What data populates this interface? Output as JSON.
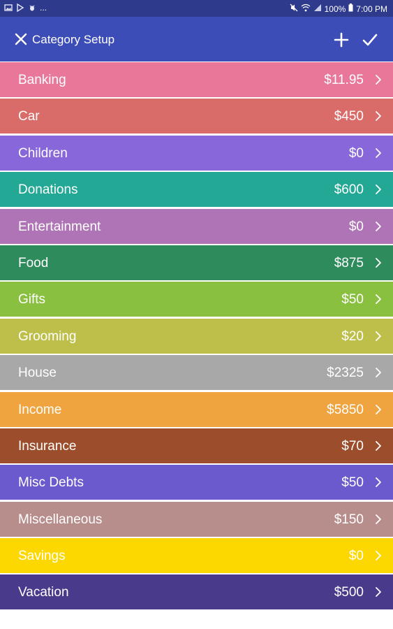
{
  "status_bar": {
    "left_icons": [
      "gallery-icon",
      "play-store-icon",
      "bug-icon"
    ],
    "overflow": "...",
    "right_icons": [
      "mute-icon",
      "wifi-icon",
      "signal-icon"
    ],
    "battery": "100%",
    "time": "7:00 PM"
  },
  "app_bar": {
    "title": "Category Setup",
    "close_icon": "close-icon",
    "add_icon": "plus-icon",
    "confirm_icon": "check-icon"
  },
  "categories": [
    {
      "name": "Banking",
      "amount": "$11.95",
      "color": "#e8779a"
    },
    {
      "name": "Car",
      "amount": "$450",
      "color": "#d96b68"
    },
    {
      "name": "Children",
      "amount": "$0",
      "color": "#8767d9"
    },
    {
      "name": "Donations",
      "amount": "$600",
      "color": "#22a895"
    },
    {
      "name": "Entertainment",
      "amount": "$0",
      "color": "#ae74b5"
    },
    {
      "name": "Food",
      "amount": "$875",
      "color": "#2e8b5c"
    },
    {
      "name": "Gifts",
      "amount": "$50",
      "color": "#8ac03f"
    },
    {
      "name": "Grooming",
      "amount": "$20",
      "color": "#bdbf4a"
    },
    {
      "name": "House",
      "amount": "$2325",
      "color": "#a8a8a8"
    },
    {
      "name": "Income",
      "amount": "$5850",
      "color": "#f0a43f"
    },
    {
      "name": "Insurance",
      "amount": "$70",
      "color": "#9c4e2c"
    },
    {
      "name": "Misc Debts",
      "amount": "$50",
      "color": "#6b5acd"
    },
    {
      "name": "Miscellaneous",
      "amount": "$150",
      "color": "#b88e8d"
    },
    {
      "name": "Savings",
      "amount": "$0",
      "color": "#fdd800"
    },
    {
      "name": "Vacation",
      "amount": "$500",
      "color": "#493a8b"
    }
  ]
}
